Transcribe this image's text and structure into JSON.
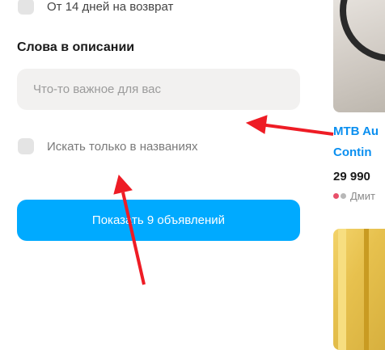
{
  "filters": {
    "return_checkbox_label": "От 14 дней на возврат",
    "description_section_title": "Слова в описании",
    "description_input_placeholder": "Что-то важное для вас",
    "description_input_value": "",
    "titles_only_checkbox_label": "Искать только в названиях",
    "titles_only_checked": false,
    "show_button_label": "Показать 9 объявлений"
  },
  "listing": {
    "title_line1": "MTB Au",
    "title_line2": "Contin",
    "price": "29 990",
    "seller": "Дмит",
    "title_color": "#0a8ff0"
  },
  "annotations": {
    "arrow_color": "#ee1c25"
  },
  "colors": {
    "accent": "#00aaff",
    "input_bg": "#f2f1f0",
    "checkbox_bg": "#e4e4e4"
  }
}
